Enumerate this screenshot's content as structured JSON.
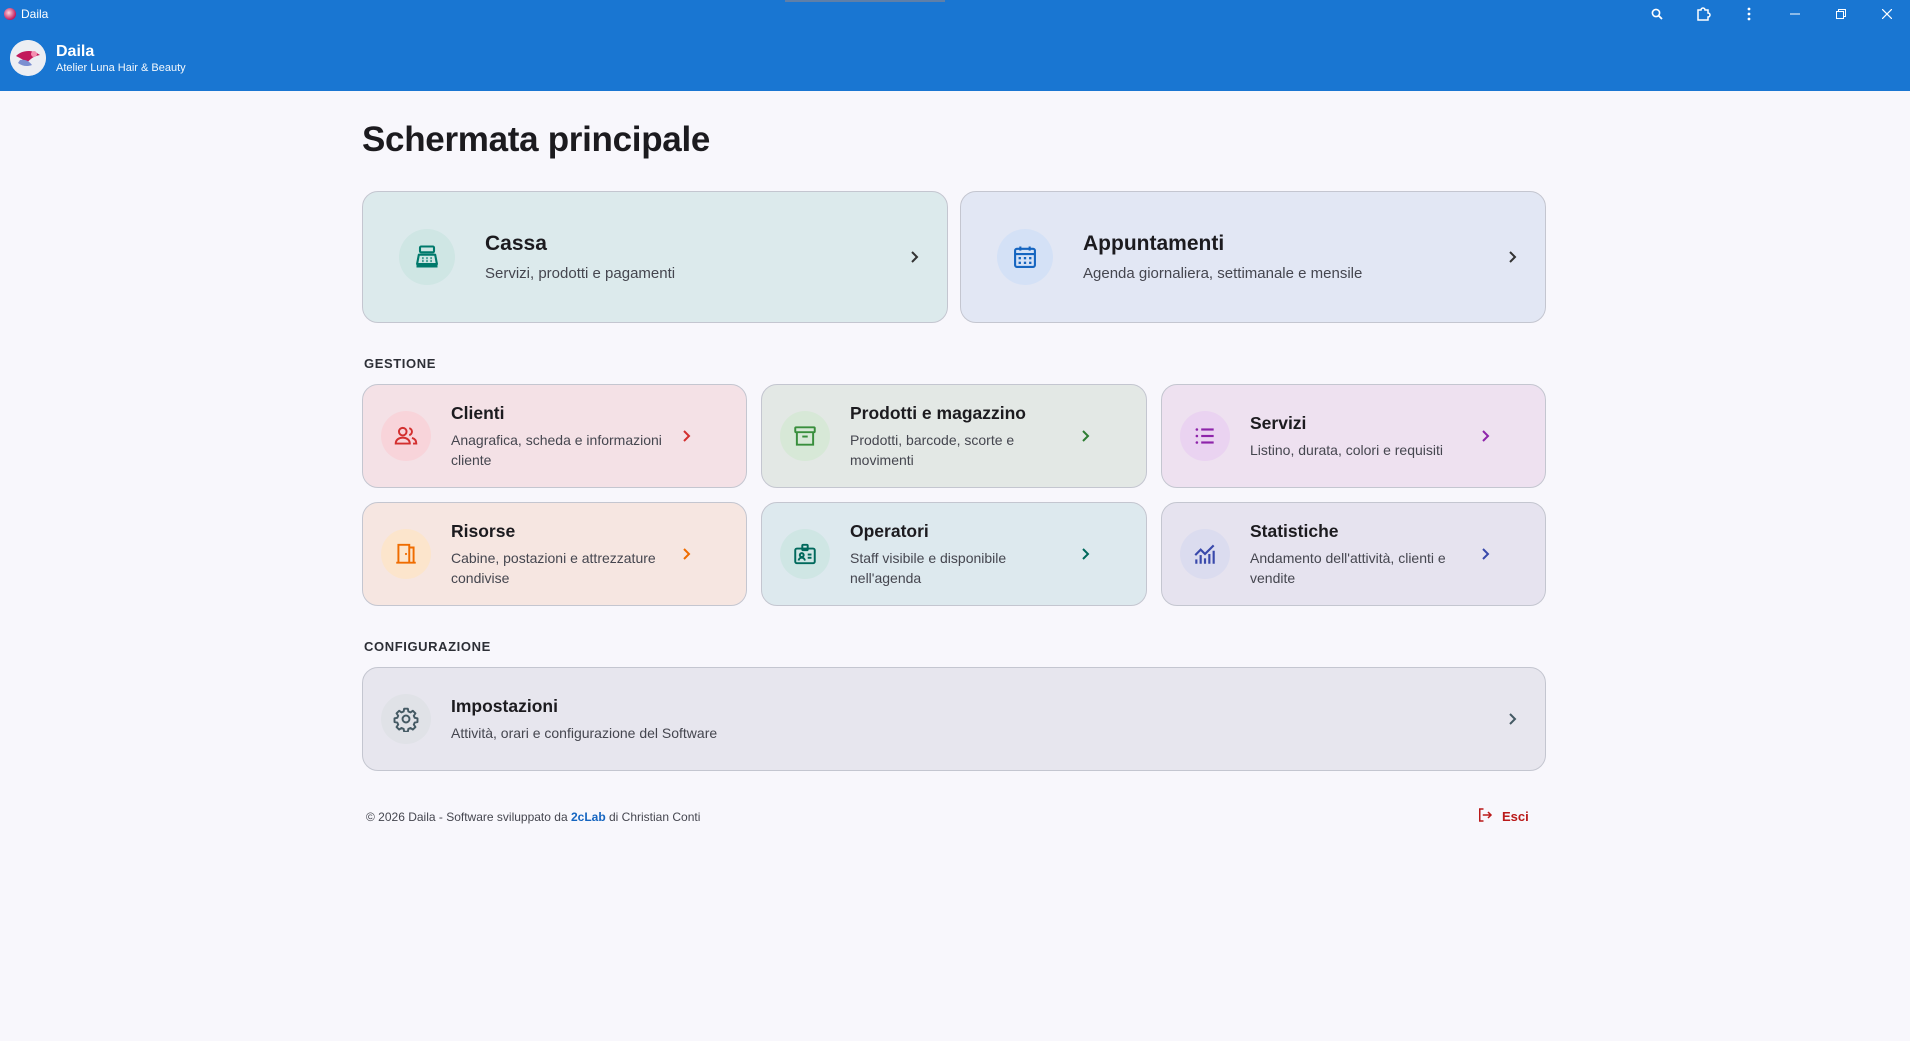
{
  "window": {
    "title": "Daila",
    "controls": [
      "search-icon",
      "extension-icon",
      "more-vert-icon",
      "minimize-icon",
      "restore-icon",
      "close-icon"
    ]
  },
  "header": {
    "app_name": "Daila",
    "business_name": "Atelier Luna Hair & Beauty"
  },
  "main": {
    "title": "Schermata principale",
    "primary_cards": [
      {
        "title": "Cassa",
        "description": "Servizi, prodotti e pagamenti",
        "icon": "cash-register-icon",
        "bg": "#dceaec",
        "icon_bg": "#cfe6e4",
        "accent": "#00796b"
      },
      {
        "title": "Appuntamenti",
        "description": "Agenda giornaliera, settimanale e mensile",
        "icon": "calendar-icon",
        "bg": "#e2e7f4",
        "icon_bg": "#d4e1f6",
        "accent": "#1565c0"
      }
    ],
    "gestione_label": "GESTIONE",
    "gestione_cards": [
      {
        "title": "Clienti",
        "description": "Anagrafica, scheda e informazioni cliente",
        "icon": "people-icon",
        "bg": "#f4e1e6",
        "icon_bg": "#f8d4da",
        "accent": "#d32f2f"
      },
      {
        "title": "Prodotti e magazzino",
        "description": "Prodotti, barcode, scorte e movimenti",
        "icon": "archive-icon",
        "bg": "#e3e8e5",
        "icon_bg": "#d7e8d7",
        "accent": "#388e3c"
      },
      {
        "title": "Servizi",
        "description": "Listino, durata, colori e requisiti",
        "icon": "list-icon",
        "bg": "#eee1f0",
        "icon_bg": "#ead3f1",
        "accent": "#8e24aa"
      },
      {
        "title": "Risorse",
        "description": "Cabine, postazioni e attrezzature condivise",
        "icon": "door-icon",
        "bg": "#f6e6e1",
        "icon_bg": "#fce5cc",
        "accent": "#ef6c00"
      },
      {
        "title": "Operatori",
        "description": "Staff visibile e disponibile nell'agenda",
        "icon": "badge-icon",
        "bg": "#dde9ee",
        "icon_bg": "#cfe6e4",
        "accent": "#00695c"
      },
      {
        "title": "Statistiche",
        "description": "Andamento dell'attività, clienti e vendite",
        "icon": "chart-icon",
        "bg": "#e6e3ef",
        "icon_bg": "#dbdcef",
        "accent": "#3949ab"
      }
    ],
    "config_label": "CONFIGURAZIONE",
    "settings_card": {
      "title": "Impostazioni",
      "description": "Attività, orari e configurazione del Software",
      "icon": "gear-icon",
      "bg": "#e7e6ee",
      "icon_bg": "#e0e2e7",
      "accent": "#455a64"
    }
  },
  "footer": {
    "copyright_prefix": "© 2026 Daila - Software sviluppato da ",
    "company_link": "2cLab",
    "copyright_suffix": " di Christian Conti",
    "logout_label": "Esci",
    "logout_color": "#ba1a1a"
  }
}
